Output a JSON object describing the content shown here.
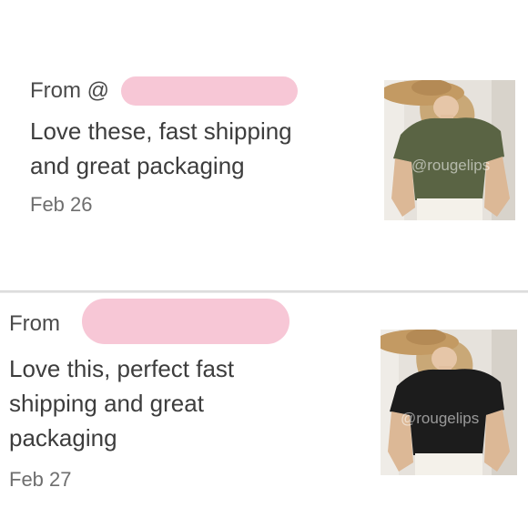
{
  "reviews": [
    {
      "from_label": "From @",
      "text_lines": [
        "Love these, fast shipping",
        "and great packaging"
      ],
      "date": "Feb 26",
      "photo": {
        "shirt_color": "#5a6444",
        "watermark": "@rougelips"
      }
    },
    {
      "from_label": "From",
      "text_lines": [
        "Love this, perfect fast",
        "shipping and great",
        "packaging"
      ],
      "date": "Feb 27",
      "photo": {
        "shirt_color": "#1c1c1c",
        "watermark": "@rougelips"
      }
    }
  ],
  "colors": {
    "redaction_pink": "#f7c7d6",
    "divider": "#d9d9d9"
  }
}
